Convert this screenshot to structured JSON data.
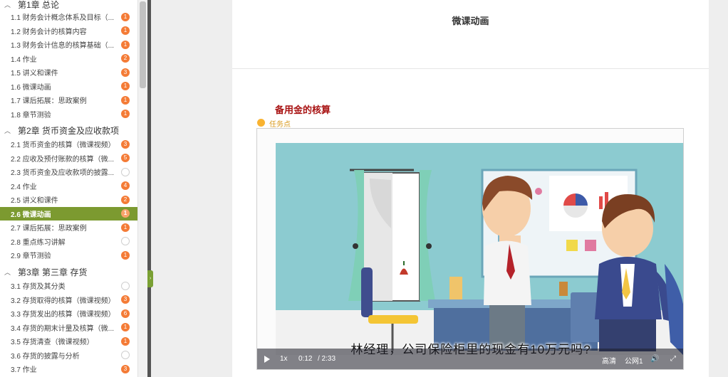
{
  "sidebar": {
    "chapters": [
      {
        "label": "第1章 总论"
      },
      {
        "label": "第2章 货币资金及应收款项"
      },
      {
        "label": "第3章 第三章 存货"
      }
    ],
    "items": [
      {
        "label": "1.1 财务会计概念体系及目标（...",
        "badge": "1"
      },
      {
        "label": "1.2 财务会计的核算内容",
        "badge": "1"
      },
      {
        "label": "1.3 财务会计信息的核算基础（...",
        "badge": "1"
      },
      {
        "label": "1.4 作业",
        "badge": "2"
      },
      {
        "label": "1.5 讲义和课件",
        "badge": "3"
      },
      {
        "label": "1.6 微课动画",
        "badge": "1"
      },
      {
        "label": "1.7 课后拓展：思政案例",
        "badge": "1"
      },
      {
        "label": "1.8 章节测验",
        "badge": "1"
      },
      {
        "label": "2.1 货币资金的核算（微课视频）",
        "badge": "3"
      },
      {
        "label": "2.2 应收及预付账款的核算（微...",
        "badge": "5"
      },
      {
        "label": "2.3 货币资金及应收款项的披露...",
        "badge": ""
      },
      {
        "label": "2.4 作业",
        "badge": "4"
      },
      {
        "label": "2.5 讲义和课件",
        "badge": "2"
      },
      {
        "label": "2.6 微课动画",
        "badge": "1"
      },
      {
        "label": "2.7 课后拓展：思政案例",
        "badge": "1"
      },
      {
        "label": "2.8 重点练习讲解",
        "badge": ""
      },
      {
        "label": "2.9 章节测验",
        "badge": "1"
      },
      {
        "label": "3.1 存货及其分类",
        "badge": ""
      },
      {
        "label": "3.2 存货取得的核算（微课视频）",
        "badge": "3"
      },
      {
        "label": "3.3 存货发出的核算（微课视频）",
        "badge": "6"
      },
      {
        "label": "3.4 存货的期末计量及核算（微...",
        "badge": "1"
      },
      {
        "label": "3.5 存货清查（微课视频）",
        "badge": "1"
      },
      {
        "label": "3.6 存货的披露与分析",
        "badge": ""
      },
      {
        "label": "3.7 作业",
        "badge": "3"
      }
    ],
    "active_item": "2.6 微课动画"
  },
  "main": {
    "page_title": "微课动画",
    "section_title": "备用金的核算",
    "task_label": "任务点"
  },
  "video": {
    "subtitle": "林经理，公司保险柜里的现金有10万元吗?",
    "speed": "1x",
    "current_time": "0:12",
    "duration": "/ 2:33",
    "quality": "高清",
    "line": "公网1"
  },
  "colors": {
    "accent_green": "#7c9a30",
    "badge_orange": "#f47b36",
    "section_red": "#a81212",
    "task_yellow": "#f9b331"
  }
}
